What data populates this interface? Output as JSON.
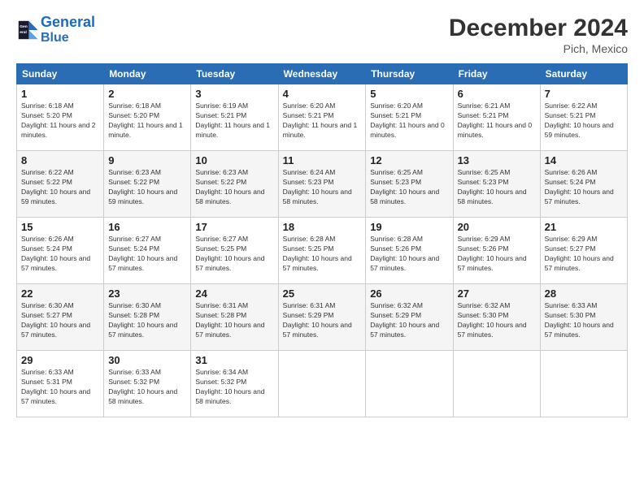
{
  "header": {
    "logo_line1": "General",
    "logo_line2": "Blue",
    "month": "December 2024",
    "location": "Pich, Mexico"
  },
  "weekdays": [
    "Sunday",
    "Monday",
    "Tuesday",
    "Wednesday",
    "Thursday",
    "Friday",
    "Saturday"
  ],
  "weeks": [
    [
      {
        "day": "1",
        "sunrise": "6:18 AM",
        "sunset": "5:20 PM",
        "daylight": "11 hours and 2 minutes."
      },
      {
        "day": "2",
        "sunrise": "6:18 AM",
        "sunset": "5:20 PM",
        "daylight": "11 hours and 1 minute."
      },
      {
        "day": "3",
        "sunrise": "6:19 AM",
        "sunset": "5:21 PM",
        "daylight": "11 hours and 1 minute."
      },
      {
        "day": "4",
        "sunrise": "6:20 AM",
        "sunset": "5:21 PM",
        "daylight": "11 hours and 1 minute."
      },
      {
        "day": "5",
        "sunrise": "6:20 AM",
        "sunset": "5:21 PM",
        "daylight": "11 hours and 0 minutes."
      },
      {
        "day": "6",
        "sunrise": "6:21 AM",
        "sunset": "5:21 PM",
        "daylight": "11 hours and 0 minutes."
      },
      {
        "day": "7",
        "sunrise": "6:22 AM",
        "sunset": "5:21 PM",
        "daylight": "10 hours and 59 minutes."
      }
    ],
    [
      {
        "day": "8",
        "sunrise": "6:22 AM",
        "sunset": "5:22 PM",
        "daylight": "10 hours and 59 minutes."
      },
      {
        "day": "9",
        "sunrise": "6:23 AM",
        "sunset": "5:22 PM",
        "daylight": "10 hours and 59 minutes."
      },
      {
        "day": "10",
        "sunrise": "6:23 AM",
        "sunset": "5:22 PM",
        "daylight": "10 hours and 58 minutes."
      },
      {
        "day": "11",
        "sunrise": "6:24 AM",
        "sunset": "5:23 PM",
        "daylight": "10 hours and 58 minutes."
      },
      {
        "day": "12",
        "sunrise": "6:25 AM",
        "sunset": "5:23 PM",
        "daylight": "10 hours and 58 minutes."
      },
      {
        "day": "13",
        "sunrise": "6:25 AM",
        "sunset": "5:23 PM",
        "daylight": "10 hours and 58 minutes."
      },
      {
        "day": "14",
        "sunrise": "6:26 AM",
        "sunset": "5:24 PM",
        "daylight": "10 hours and 57 minutes."
      }
    ],
    [
      {
        "day": "15",
        "sunrise": "6:26 AM",
        "sunset": "5:24 PM",
        "daylight": "10 hours and 57 minutes."
      },
      {
        "day": "16",
        "sunrise": "6:27 AM",
        "sunset": "5:24 PM",
        "daylight": "10 hours and 57 minutes."
      },
      {
        "day": "17",
        "sunrise": "6:27 AM",
        "sunset": "5:25 PM",
        "daylight": "10 hours and 57 minutes."
      },
      {
        "day": "18",
        "sunrise": "6:28 AM",
        "sunset": "5:25 PM",
        "daylight": "10 hours and 57 minutes."
      },
      {
        "day": "19",
        "sunrise": "6:28 AM",
        "sunset": "5:26 PM",
        "daylight": "10 hours and 57 minutes."
      },
      {
        "day": "20",
        "sunrise": "6:29 AM",
        "sunset": "5:26 PM",
        "daylight": "10 hours and 57 minutes."
      },
      {
        "day": "21",
        "sunrise": "6:29 AM",
        "sunset": "5:27 PM",
        "daylight": "10 hours and 57 minutes."
      }
    ],
    [
      {
        "day": "22",
        "sunrise": "6:30 AM",
        "sunset": "5:27 PM",
        "daylight": "10 hours and 57 minutes."
      },
      {
        "day": "23",
        "sunrise": "6:30 AM",
        "sunset": "5:28 PM",
        "daylight": "10 hours and 57 minutes."
      },
      {
        "day": "24",
        "sunrise": "6:31 AM",
        "sunset": "5:28 PM",
        "daylight": "10 hours and 57 minutes."
      },
      {
        "day": "25",
        "sunrise": "6:31 AM",
        "sunset": "5:29 PM",
        "daylight": "10 hours and 57 minutes."
      },
      {
        "day": "26",
        "sunrise": "6:32 AM",
        "sunset": "5:29 PM",
        "daylight": "10 hours and 57 minutes."
      },
      {
        "day": "27",
        "sunrise": "6:32 AM",
        "sunset": "5:30 PM",
        "daylight": "10 hours and 57 minutes."
      },
      {
        "day": "28",
        "sunrise": "6:33 AM",
        "sunset": "5:30 PM",
        "daylight": "10 hours and 57 minutes."
      }
    ],
    [
      {
        "day": "29",
        "sunrise": "6:33 AM",
        "sunset": "5:31 PM",
        "daylight": "10 hours and 57 minutes."
      },
      {
        "day": "30",
        "sunrise": "6:33 AM",
        "sunset": "5:32 PM",
        "daylight": "10 hours and 58 minutes."
      },
      {
        "day": "31",
        "sunrise": "6:34 AM",
        "sunset": "5:32 PM",
        "daylight": "10 hours and 58 minutes."
      },
      null,
      null,
      null,
      null
    ]
  ]
}
